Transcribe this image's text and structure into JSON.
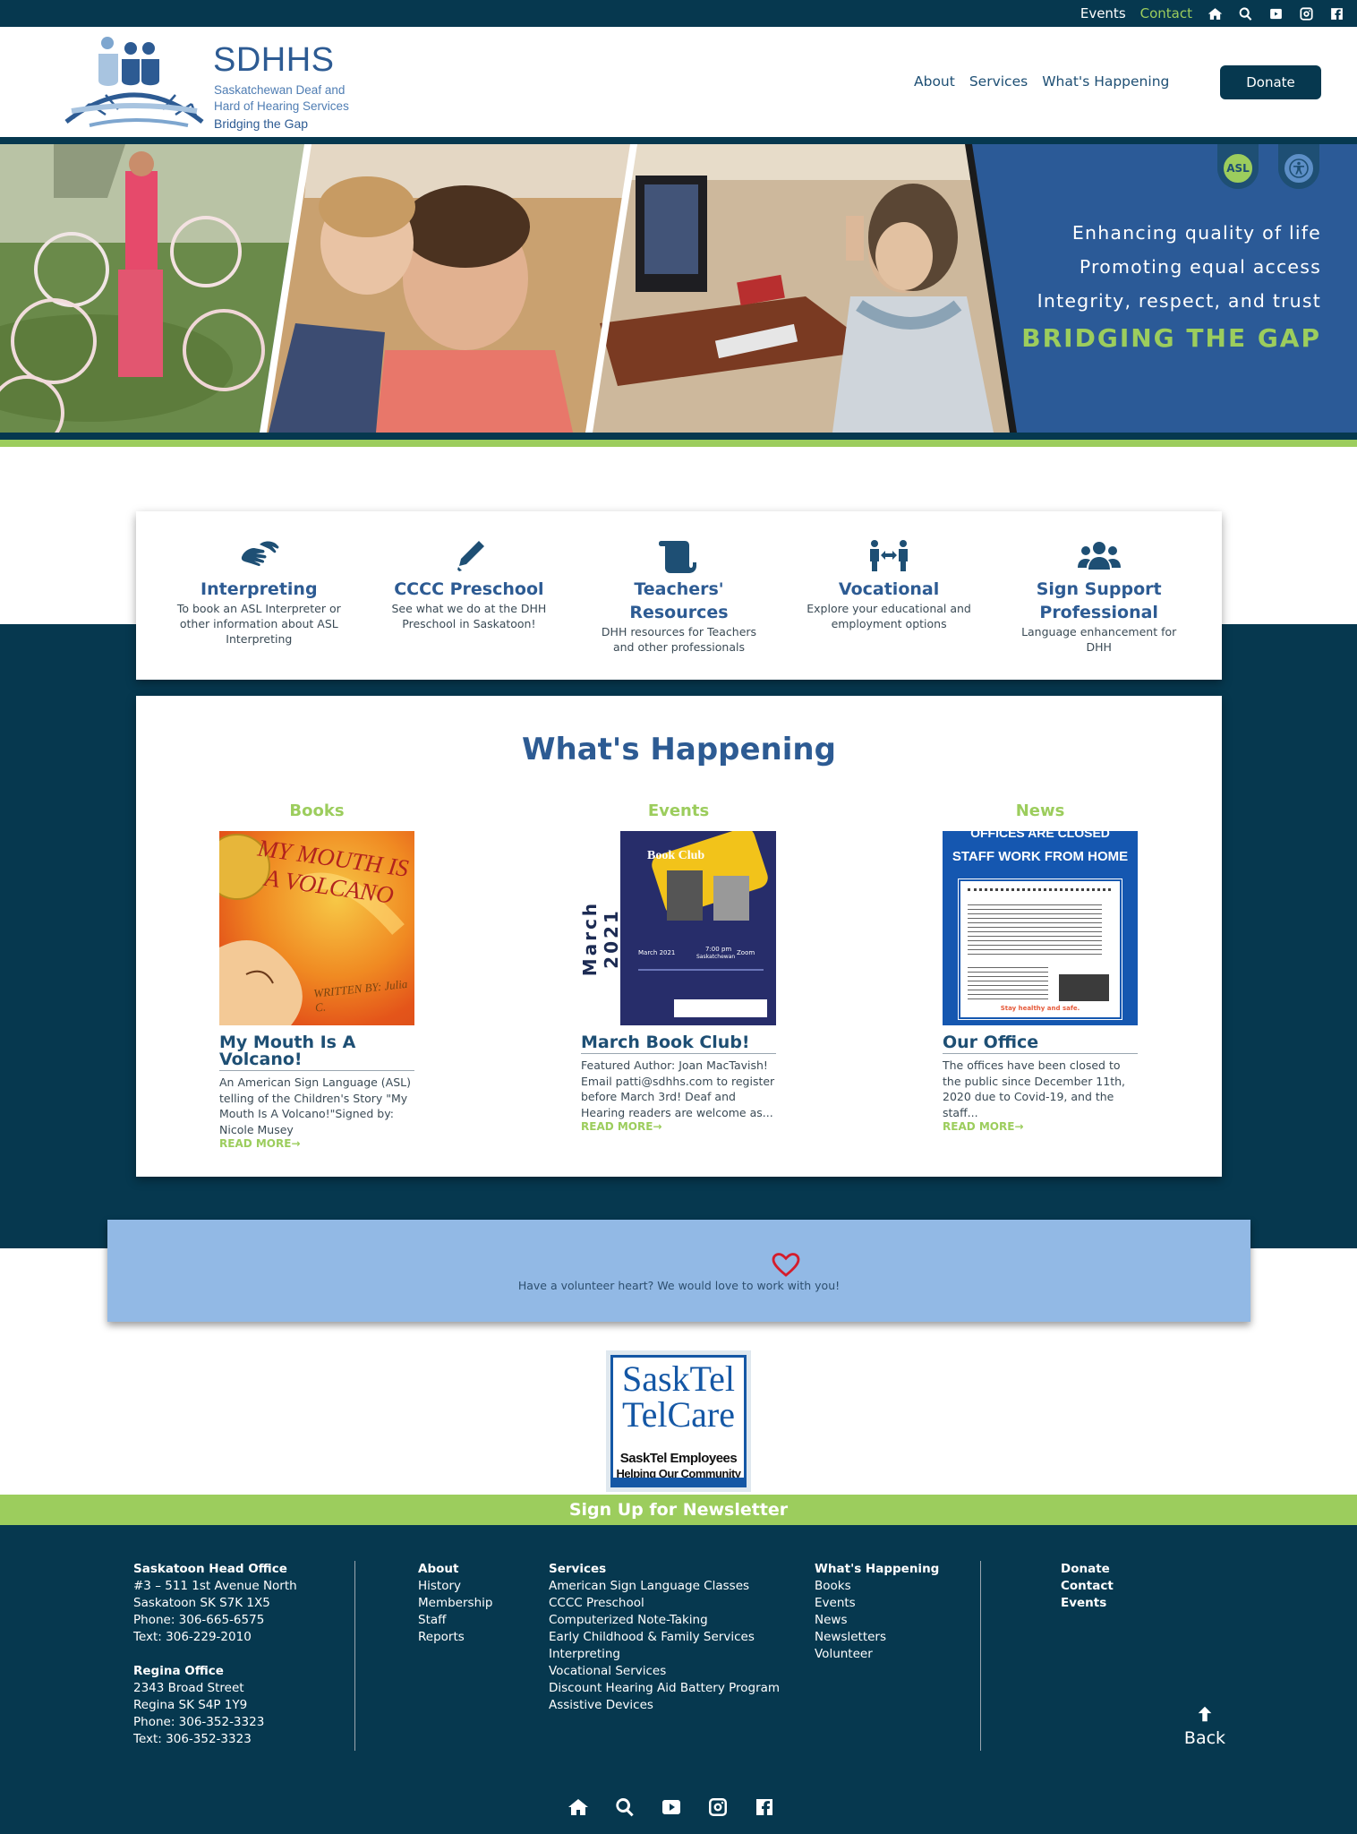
{
  "topbar": {
    "events_label": "Events",
    "contact_label": "Contact",
    "icons": [
      "home-icon",
      "search-icon",
      "youtube-icon",
      "instagram-icon",
      "facebook-icon"
    ]
  },
  "header": {
    "logo_title": "SDHHS",
    "logo_subtitle": "Saskatchewan Deaf and Hard of Hearing Services",
    "logo_tagline": "Bridging the Gap",
    "nav": [
      "About",
      "Services",
      "What's Happening"
    ],
    "donate_label": "Donate"
  },
  "hero": {
    "lines": [
      "Enhancing quality of life",
      "Promoting equal access",
      "Integrity, respect, and trust"
    ],
    "slogan": "BRIDGING THE GAP",
    "asl_badge": "ASL"
  },
  "services": [
    {
      "title": "Interpreting",
      "desc": "To book an ASL Interpreter or other information about ASL Interpreting",
      "icon": "sign-language-icon"
    },
    {
      "title": "CCCC Preschool",
      "desc": "See what we do at the DHH Preschool in Saskatoon!",
      "icon": "pencil-icon"
    },
    {
      "title": "Teachers' Resources",
      "desc": "DHH resources for Teachers and other professionals",
      "icon": "scroll-icon"
    },
    {
      "title": "Vocational",
      "desc": "Explore your educational and employment options",
      "icon": "people-arrows-icon"
    },
    {
      "title": "Sign Support Professional",
      "desc": "Language enhancement for DHH",
      "icon": "users-icon"
    }
  ],
  "whats_happening": {
    "title": "What's Happening",
    "columns": [
      {
        "category": "Books",
        "title": "My Mouth Is A Volcano!",
        "desc": "An American Sign Language (ASL) telling of the Children's Story \"My Mouth Is A Volcano!\"Signed by: Nicole Musey",
        "readmore": "READ MORE→",
        "thumb_text": "MY MOUTH IS A VOLCANO",
        "thumb_credit": "WRITTEN BY: Julia C."
      },
      {
        "category": "Events",
        "title": "March Book Club!",
        "desc": "Featured Author: Joan MacTavish! Email patti@sdhhs.com to register before March 3rd! Deaf and Hearing readers are welcome as...",
        "readmore": "READ MORE→",
        "thumb_side": "March 2021",
        "thumb_poster_title": "Book Club",
        "thumb_poster_date": "March 2021",
        "thumb_poster_time": "7:00 pm",
        "thumb_poster_loc": "Saskatchewan",
        "thumb_poster_zoom": "Zoom"
      },
      {
        "category": "News",
        "title": "Our Office",
        "desc": "The offices have been closed to the public since December 11th, 2020 due to Covid-19, and the staff...",
        "readmore": "READ MORE→",
        "thumb_head1": "OFFICES ARE CLOSED",
        "thumb_head2": "STAFF WORK FROM HOME",
        "thumb_foot": "Stay healthy and safe."
      }
    ]
  },
  "volunteer": {
    "text": "Have a volunteer heart? We would love to work with you!",
    "icon": "heart-icon"
  },
  "sponsor": {
    "line1": "SaskTel",
    "line2": "TelCare",
    "line3": "SaskTel Employees",
    "line4": "Helping Our Community"
  },
  "newsletter": {
    "label": "Sign Up for Newsletter"
  },
  "footer": {
    "saskatoon": {
      "heading": "Saskatoon Head Office",
      "lines": [
        "#3 – 511 1st Avenue North",
        "Saskatoon SK S7K 1X5",
        "Phone: 306-665-6575",
        "Text: 306-229-2010"
      ]
    },
    "regina": {
      "heading": "Regina Office",
      "lines": [
        "2343 Broad Street",
        "Regina SK S4P 1Y9",
        "Phone: 306-352-3323",
        "Text: 306-352-3323"
      ]
    },
    "about": {
      "heading": "About",
      "links": [
        "History",
        "Membership",
        "Staff",
        "Reports"
      ]
    },
    "services": {
      "heading": "Services",
      "links": [
        "American Sign Language Classes",
        "CCCC Preschool",
        "Computerized Note-Taking",
        "Early Childhood & Family Services",
        "Interpreting",
        "Vocational Services",
        "Discount Hearing Aid Battery Program",
        "Assistive Devices"
      ]
    },
    "happening": {
      "heading": "What's Happening",
      "links": [
        "Books",
        "Events",
        "News",
        "Newsletters",
        "Volunteer"
      ]
    },
    "extra": [
      "Donate",
      "Contact",
      "Events"
    ],
    "back_label": "Back",
    "icons": [
      "home-icon",
      "search-icon",
      "youtube-icon",
      "instagram-icon",
      "facebook-icon"
    ]
  },
  "colors": {
    "navy": "#06384f",
    "blue": "#2b5a97",
    "green": "#9ccd5d",
    "light_blue": "#92b9e5"
  }
}
